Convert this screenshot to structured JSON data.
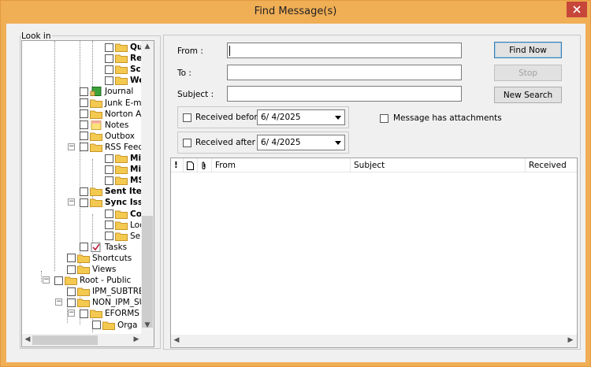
{
  "window": {
    "title": "Find Message(s)"
  },
  "look_in": {
    "label": "Look in",
    "tree": [
      {
        "label": "Quix",
        "bold": true
      },
      {
        "label": "Resu",
        "bold": true
      },
      {
        "label": "Scho",
        "bold": true
      },
      {
        "label": "Web",
        "bold": true
      },
      {
        "label": "Journal",
        "bold": false
      },
      {
        "label": "Junk E-m",
        "bold": false
      },
      {
        "label": "Norton A",
        "bold": false
      },
      {
        "label": "Notes",
        "bold": false
      },
      {
        "label": "Outbox",
        "bold": false
      },
      {
        "label": "RSS Feed",
        "bold": false
      },
      {
        "label": "Micro",
        "bold": true
      },
      {
        "label": "Micro",
        "bold": true
      },
      {
        "label": "MSN",
        "bold": true
      },
      {
        "label": "Sent Item",
        "bold": true
      },
      {
        "label": "Sync Issu",
        "bold": true
      },
      {
        "label": "Conf",
        "bold": true
      },
      {
        "label": "Local",
        "bold": false
      },
      {
        "label": "Serve",
        "bold": false
      },
      {
        "label": "Tasks",
        "bold": false
      },
      {
        "label": "Shortcuts",
        "bold": false
      },
      {
        "label": "Views",
        "bold": false
      },
      {
        "label": "Root - Public",
        "bold": false
      },
      {
        "label": "IPM_SUBTRE",
        "bold": false
      },
      {
        "label": "NON_IPM_SU",
        "bold": false
      },
      {
        "label": "EFORMS",
        "bold": false
      },
      {
        "label": "Orga",
        "bold": false
      }
    ]
  },
  "criteria": {
    "from_label": "From :",
    "from_value": "",
    "to_label": "To :",
    "to_value": "",
    "subject_label": "Subject :",
    "subject_value": "",
    "received_before_label": "Received before :",
    "received_before_value": "6/ 4/2025",
    "received_after_label": "Received after :",
    "received_after_value": "6/ 4/2025",
    "attachments_label": "Message has attachments"
  },
  "buttons": {
    "find_now": "Find Now",
    "stop": "Stop",
    "new_search": "New Search"
  },
  "results": {
    "columns": [
      "!",
      "",
      "",
      "From",
      "Subject",
      "Received"
    ]
  },
  "icons": {
    "importance": "exclamation-icon",
    "item_type": "document-icon",
    "attachment": "paperclip-icon",
    "folder": "folder-icon",
    "journal": "journal-icon",
    "notes": "notes-icon",
    "tasks": "tasks-icon",
    "close": "close-icon"
  },
  "colors": {
    "title_bar": "#f0ae55",
    "folder": "#f3c94f",
    "close_button": "#c7463a"
  }
}
